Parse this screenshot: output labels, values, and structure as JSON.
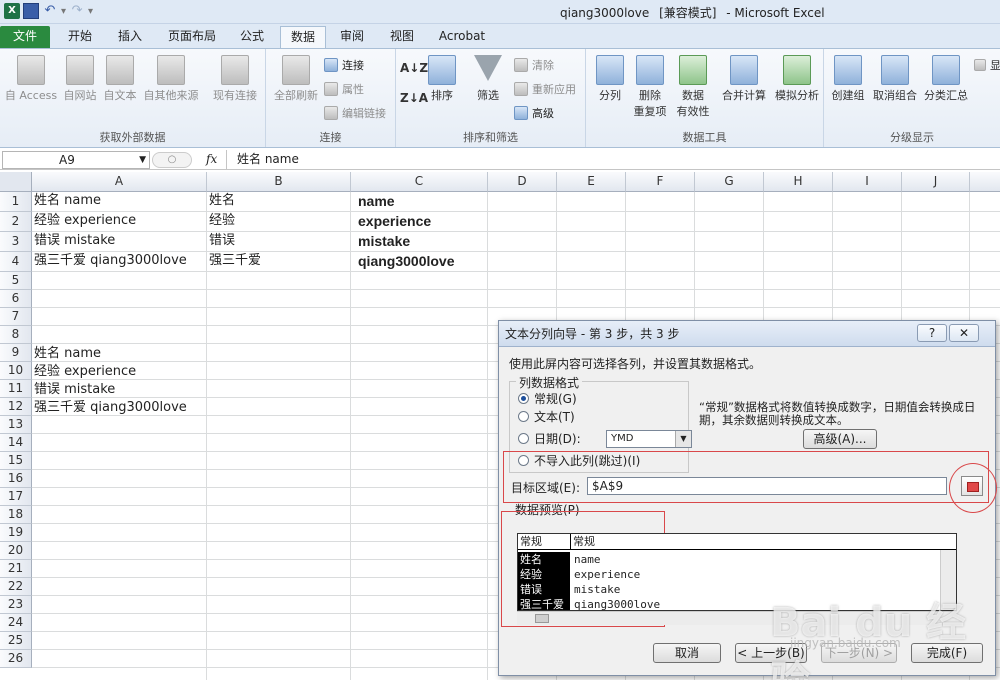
{
  "window": {
    "title": "qiang3000love",
    "mode": "[兼容模式]",
    "app": "- Microsoft Excel"
  },
  "ribbon_tabs": [
    "文件",
    "开始",
    "插入",
    "页面布局",
    "公式",
    "数据",
    "审阅",
    "视图",
    "Acrobat"
  ],
  "ribbon": {
    "get_external": {
      "label": "获取外部数据",
      "access": "自 Access",
      "web": "自网站",
      "text": "自文本",
      "other": "自其他来源",
      "existing": "现有连接"
    },
    "connections": {
      "label": "连接",
      "refresh_all": "全部刷新",
      "connect": "连接",
      "properties": "属性",
      "edit_links": "编辑链接"
    },
    "sort_filter": {
      "label": "排序和筛选",
      "sort": "排序",
      "filter": "筛选",
      "clear": "清除",
      "reapply": "重新应用",
      "advanced": "高级"
    },
    "data_tools": {
      "label": "数据工具",
      "text_to_columns": "分列",
      "remove_dup_1": "删除",
      "remove_dup_2": "重复项",
      "validation_1": "数据",
      "validation_2": "有效性",
      "consolidate": "合并计算",
      "what_if": "模拟分析"
    },
    "outline": {
      "label": "分级显示",
      "group": "创建组",
      "ungroup": "取消组合",
      "subtotal": "分类汇总",
      "show": "显"
    }
  },
  "formula_bar": {
    "name_box": "A9",
    "fx": "fx",
    "content": "姓名 name"
  },
  "grid": {
    "columns": [
      "A",
      "B",
      "C",
      "D",
      "E",
      "F",
      "G",
      "H",
      "I",
      "J"
    ],
    "rows": [
      "1",
      "2",
      "3",
      "4",
      "5",
      "6",
      "7",
      "8",
      "9",
      "10",
      "11",
      "12",
      "13",
      "14",
      "15",
      "16",
      "17",
      "18",
      "19",
      "20",
      "21",
      "22",
      "23",
      "24",
      "25",
      "26"
    ],
    "col_a": [
      "姓名 name",
      "经验 experience",
      "错误 mistake",
      "强三千爱 qiang3000love"
    ],
    "col_b": [
      "姓名",
      "经验",
      "错误",
      "强三千爱"
    ],
    "col_c": [
      "name",
      "experience",
      "mistake",
      "qiang3000love"
    ],
    "col_a_lower": [
      "姓名 name",
      "经验 experience",
      "错误 mistake",
      "强三千爱 qiang3000love"
    ]
  },
  "dialog": {
    "title": "文本分列向导 - 第 3 步，共 3 步",
    "help": "?",
    "close": "✕",
    "instruction": "使用此屏内容可选择各列，并设置其数据格式。",
    "format_legend": "列数据格式",
    "opt_general": "常规(G)",
    "opt_text": "文本(T)",
    "opt_date": "日期(D):",
    "date_format": "YMD",
    "opt_skip": "不导入此列(跳过)(I)",
    "desc": "“常规”数据格式将数值转换成数字，日期值会转换成日期，其余数据则转换成文本。",
    "advanced": "高级(A)...",
    "dest_label": "目标区域(E):",
    "dest_value": "$A$9",
    "preview_label": "数据预览(P)",
    "preview_head": [
      "常规",
      "常规"
    ],
    "preview_col1": [
      "姓名",
      "经验",
      "错误",
      "强三千爱"
    ],
    "preview_col2": [
      "name",
      "experience",
      "mistake",
      "qiang3000love"
    ],
    "cancel": "取消",
    "back": "< 上一步(B)",
    "next": "下一步(N) >",
    "finish": "完成(F)"
  },
  "watermark": {
    "brand": "Bai du 经验",
    "url": "jingyan.baidu.com"
  },
  "colors": {
    "file_tab": "#2a8a3f",
    "annotation": "#d9484a",
    "selection": "#000000"
  }
}
